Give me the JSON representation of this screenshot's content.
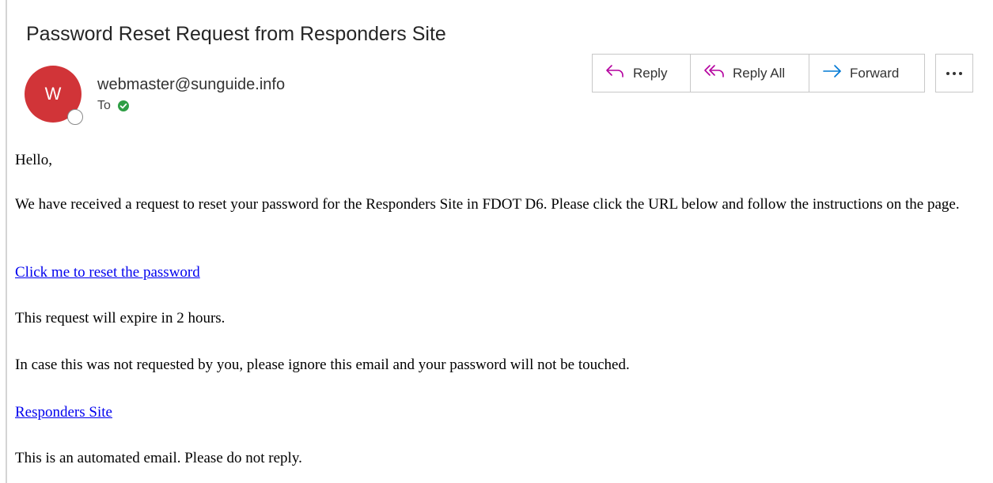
{
  "email": {
    "subject": "Password Reset Request from Responders Site",
    "sender": {
      "initial": "W",
      "address": "webmaster@sunguide.info",
      "to_label": "To"
    },
    "actions": {
      "reply": "Reply",
      "reply_all": "Reply All",
      "forward": "Forward",
      "more": "More actions"
    },
    "body": {
      "greeting": "Hello,",
      "paragraph1": "We have received a request to reset your password for the Responders Site in FDOT D6. Please click the URL below and follow the instructions on the page.",
      "reset_link": "Click me to reset the password",
      "expiry": "This request will expire in 2 hours.",
      "ignore_notice": "In case this was not requested by you, please ignore this email and your password will not be touched.",
      "site_link": "Responders Site",
      "automated_notice": "This is an automated email. Please do not reply."
    }
  },
  "colors": {
    "avatar": "#d13438",
    "accent_reply": "#b4009e",
    "accent_forward": "#0078d4",
    "verified": "#2e9e44",
    "link": "#0000ee"
  },
  "icons": {
    "reply": "reply-arrow-icon",
    "reply_all": "reply-all-arrow-icon",
    "forward": "forward-arrow-icon",
    "verified": "verified-check-icon",
    "more": "ellipsis-icon"
  }
}
